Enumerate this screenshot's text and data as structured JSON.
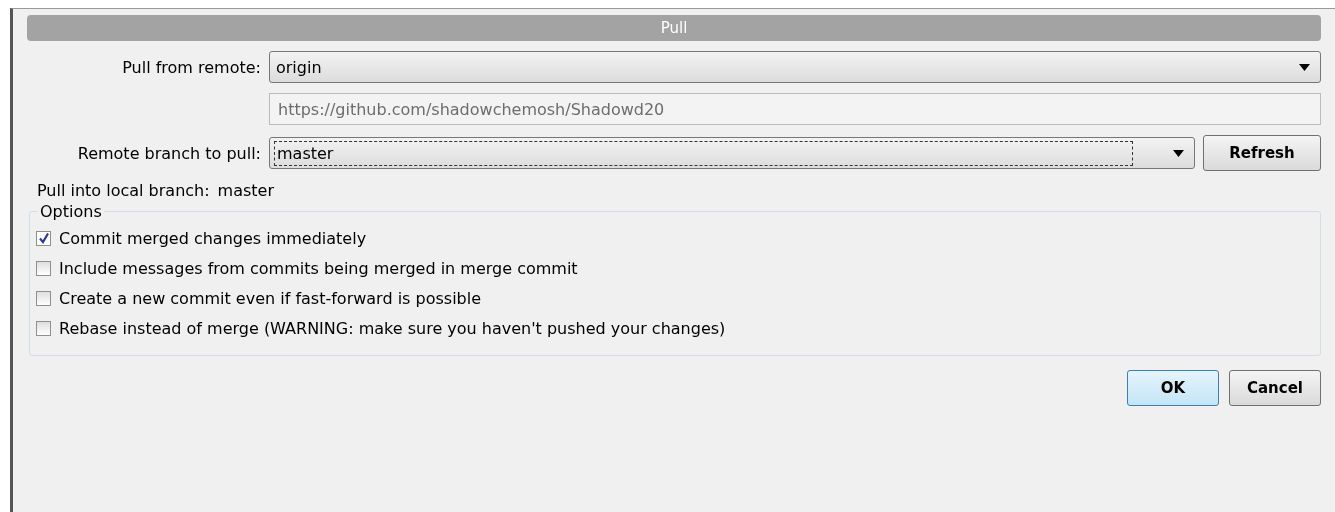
{
  "window": {
    "title": "Pull"
  },
  "remote": {
    "label": "Pull from remote:",
    "value": "origin",
    "url": "https://github.com/shadowchemosh/Shadowd20"
  },
  "branch": {
    "label": "Remote branch to pull:",
    "value": "master",
    "refresh": "Refresh"
  },
  "local": {
    "label": "Pull into local branch:",
    "value": "master"
  },
  "options": {
    "title": "Options",
    "items": [
      {
        "label": "Commit merged changes immediately",
        "checked": true
      },
      {
        "label": "Include messages from commits being merged in merge commit",
        "checked": false
      },
      {
        "label": "Create a new commit even if fast-forward is possible",
        "checked": false
      },
      {
        "label": "Rebase instead of merge (WARNING: make sure you haven't pushed your changes)",
        "checked": false
      }
    ]
  },
  "buttons": [
    {
      "label": "OK",
      "kind": "default"
    },
    {
      "label": "Cancel",
      "kind": "normal"
    }
  ]
}
